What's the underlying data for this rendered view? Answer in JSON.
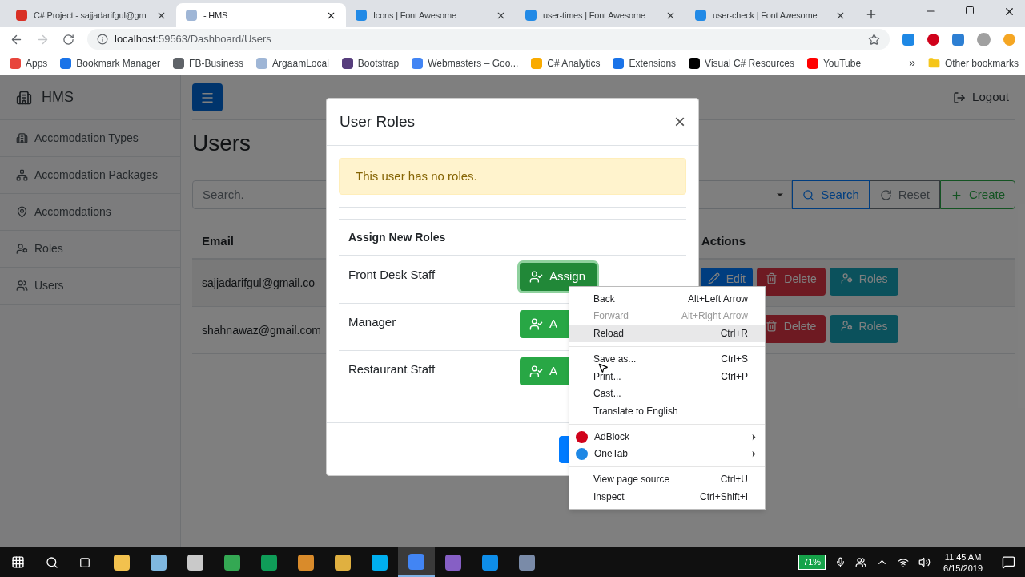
{
  "browser": {
    "tabs": [
      {
        "title": "C# Project - sajjadarifgul@gm",
        "selected": false,
        "color": "#d93025"
      },
      {
        "title": "- HMS",
        "selected": true,
        "color": "#9fb6d6"
      },
      {
        "title": "Icons | Font Awesome",
        "selected": false,
        "color": "#228ae6"
      },
      {
        "title": "user-times | Font Awesome",
        "selected": false,
        "color": "#228ae6"
      },
      {
        "title": "user-check | Font Awesome",
        "selected": false,
        "color": "#228ae6"
      }
    ],
    "address": {
      "host": "localhost",
      "path": ":59563/Dashboard/Users"
    },
    "bookmarks": [
      {
        "label": "Apps",
        "color": "#e8453c"
      },
      {
        "label": "Bookmark Manager",
        "color": "#1a73e8"
      },
      {
        "label": "FB-Business",
        "color": "#5f6368"
      },
      {
        "label": "ArgaamLocal",
        "color": "#9fb6d6"
      },
      {
        "label": "Bootstrap",
        "color": "#563d7c"
      },
      {
        "label": "Webmasters – Goo...",
        "color": "#4285f4"
      },
      {
        "label": "C# Analytics",
        "color": "#f9ab00"
      },
      {
        "label": "Extensions",
        "color": "#1a73e8"
      },
      {
        "label": "Visual C# Resources",
        "color": "#000000"
      },
      {
        "label": "YouTube",
        "color": "#ff0000"
      }
    ],
    "overflow": "»",
    "other_bookmarks": "Other bookmarks"
  },
  "sidebar": {
    "brand": "HMS",
    "items": [
      {
        "label": "Accomodation Types",
        "kind": "building"
      },
      {
        "label": "Accomodation Packages",
        "kind": "network"
      },
      {
        "label": "Accomodations",
        "kind": "pin"
      },
      {
        "label": "Roles",
        "kind": "roles"
      },
      {
        "label": "Users",
        "kind": "users"
      }
    ]
  },
  "header": {
    "logout": "Logout"
  },
  "page": {
    "title": "Users",
    "search": {
      "placeholder": "Search."
    },
    "buttons": [
      {
        "label": "Search",
        "kind": "search"
      },
      {
        "label": "Reset",
        "kind": "reset"
      },
      {
        "label": "Create",
        "kind": "create"
      }
    ],
    "table": {
      "columns": [
        "Email",
        "Actions"
      ],
      "rows": [
        {
          "email": "sajjadarifgul@gmail.co",
          "actions": [
            {
              "label": "Edit",
              "kind": "edit"
            },
            {
              "label": "Delete",
              "kind": "delete"
            },
            {
              "label": "Roles",
              "kind": "roles"
            }
          ]
        },
        {
          "email": "shahnawaz@gmail.com",
          "actions": [
            {
              "label": "Delete",
              "kind": "delete"
            },
            {
              "label": "Roles",
              "kind": "roles"
            }
          ]
        }
      ]
    }
  },
  "modal": {
    "title": "User Roles",
    "close": "×",
    "alert": "This user has no roles.",
    "section": "Assign New Roles",
    "roles": [
      {
        "name": "Front Desk Staff",
        "button": "Assign",
        "focused": true
      },
      {
        "name": "Manager",
        "button": "A",
        "focused": false
      },
      {
        "name": "Restaurant Staff",
        "button": "A",
        "focused": false
      }
    ]
  },
  "context_menu": {
    "items": [
      {
        "kind": "item",
        "label": "Back",
        "shortcut": "Alt+Left Arrow",
        "disabled": false,
        "selected": false
      },
      {
        "kind": "item",
        "label": "Forward",
        "shortcut": "Alt+Right Arrow",
        "disabled": true,
        "selected": false
      },
      {
        "kind": "item",
        "label": "Reload",
        "shortcut": "Ctrl+R",
        "disabled": false,
        "selected": true
      },
      {
        "kind": "separator"
      },
      {
        "kind": "item",
        "label": "Save as...",
        "shortcut": "Ctrl+S",
        "disabled": false,
        "selected": false
      },
      {
        "kind": "item",
        "label": "Print...",
        "shortcut": "Ctrl+P",
        "disabled": false,
        "selected": false
      },
      {
        "kind": "item",
        "label": "Cast...",
        "disabled": false,
        "selected": false
      },
      {
        "kind": "item",
        "label": "Translate to English",
        "disabled": false,
        "selected": false
      },
      {
        "kind": "separator"
      },
      {
        "kind": "extension",
        "label": "AdBlock",
        "color": "#d0021b"
      },
      {
        "kind": "extension",
        "label": "OneTab",
        "color": "#1e88e5"
      },
      {
        "kind": "separator"
      },
      {
        "kind": "item",
        "label": "View page source",
        "shortcut": "Ctrl+U",
        "disabled": false,
        "selected": false
      },
      {
        "kind": "item",
        "label": "Inspect",
        "shortcut": "Ctrl+Shift+I",
        "disabled": false,
        "selected": false
      }
    ]
  },
  "taskbar": {
    "apps": [
      {
        "color": "#f2c14e",
        "selected": false
      },
      {
        "color": "#7fb8e0",
        "selected": false
      },
      {
        "color": "#c9c9c9",
        "selected": false
      },
      {
        "color": "#34a853",
        "selected": false
      },
      {
        "color": "#0f9d58",
        "selected": false
      },
      {
        "color": "#d98b2b",
        "selected": false
      },
      {
        "color": "#e0b040",
        "selected": false
      },
      {
        "color": "#00aff0",
        "selected": false
      },
      {
        "color": "#4285f4",
        "selected": true
      },
      {
        "color": "#865fc5",
        "selected": false
      },
      {
        "color": "#0e8ee9",
        "selected": false
      },
      {
        "color": "#7a8ba8",
        "selected": false
      }
    ],
    "battery": "71%",
    "time": "11:45 AM",
    "date": "6/15/2019"
  }
}
